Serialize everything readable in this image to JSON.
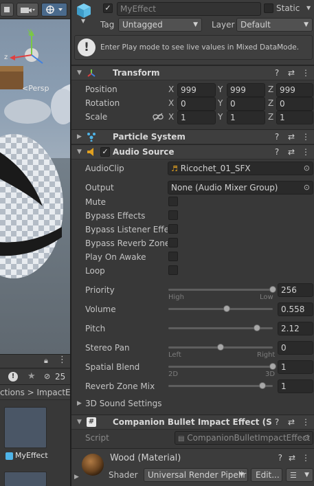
{
  "scene": {
    "persp_label": "<Persp",
    "icons": [
      "hand-tool-icon",
      "camera-icon",
      "gizmo-icon"
    ]
  },
  "project": {
    "crumbs": "ctions > ImpactEffe",
    "hidden_count": "25",
    "asset_name": "MyEffect"
  },
  "header": {
    "name": "MyEffect",
    "static_label": "Static",
    "tag_label": "Tag",
    "tag_value": "Untagged",
    "layer_label": "Layer",
    "layer_value": "Default",
    "help_text": "Enter Play mode to see live values in Mixed DataMode."
  },
  "transform": {
    "title": "Transform",
    "position_label": "Position",
    "rotation_label": "Rotation",
    "scale_label": "Scale",
    "axis_x": "X",
    "axis_y": "Y",
    "axis_z": "Z",
    "position": [
      "999",
      "999",
      "999"
    ],
    "rotation": [
      "0",
      "0",
      "0"
    ],
    "scale": [
      "1",
      "1",
      "1"
    ]
  },
  "particle_system": {
    "title": "Particle System"
  },
  "audio_source": {
    "title": "Audio Source",
    "audio_clip_label": "AudioClip",
    "audio_clip_value": "Ricochet_01_SFX",
    "output_label": "Output",
    "output_value": "None (Audio Mixer Group)",
    "mute_label": "Mute",
    "bypass_effects_label": "Bypass Effects",
    "bypass_listener_label": "Bypass Listener Effec",
    "bypass_reverb_label": "Bypass Reverb Zones",
    "play_on_awake_label": "Play On Awake",
    "loop_label": "Loop",
    "priority_label": "Priority",
    "priority_value": "256",
    "priority_min_label": "High",
    "priority_max_label": "Low",
    "priority_fraction": 1.0,
    "volume_label": "Volume",
    "volume_value": "0.558",
    "volume_fraction": 0.558,
    "pitch_label": "Pitch",
    "pitch_value": "2.12",
    "pitch_fraction": 0.85,
    "stereo_pan_label": "Stereo Pan",
    "stereo_pan_value": "0",
    "stereo_pan_min_label": "Left",
    "stereo_pan_max_label": "Right",
    "stereo_pan_fraction": 0.5,
    "spatial_blend_label": "Spatial Blend",
    "spatial_blend_value": "1",
    "spatial_blend_min_label": "2D",
    "spatial_blend_max_label": "3D",
    "spatial_blend_fraction": 1.0,
    "reverb_zone_label": "Reverb Zone Mix",
    "reverb_zone_value": "1",
    "reverb_zone_fraction": 0.9,
    "sound_settings_label": "3D Sound Settings"
  },
  "script_component": {
    "title": "Companion Bullet Impact Effect (Script)",
    "script_label": "Script",
    "script_value": "CompanionBulletImpactEffect"
  },
  "material": {
    "title": "Wood (Material)",
    "shader_label": "Shader",
    "shader_value": "Universal Render Pipelir",
    "edit_label": "Edit..."
  },
  "colors": {
    "accent": "#4a6a8c",
    "audio_icon": "#e0a020",
    "transform_icon": "#e0b040",
    "particle_icon": "#4fb4e8"
  }
}
